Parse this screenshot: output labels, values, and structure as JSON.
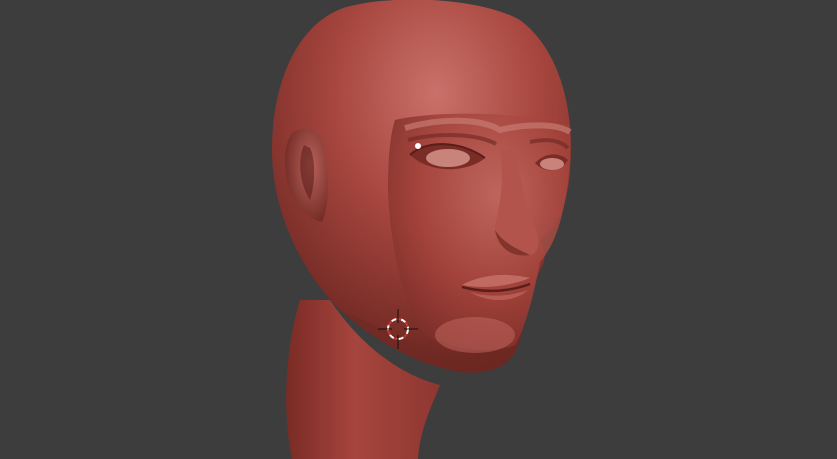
{
  "viewport": {
    "background_color": "#3d3d3d",
    "mode": "sculpt"
  },
  "model": {
    "object": "head-sculpt",
    "base_color": "#a8473f",
    "highlight_color": "#c9716a",
    "shadow_color": "#5e201c"
  },
  "cursor": {
    "icon": "3d-cursor-icon",
    "ring_color_a": "#ffffff",
    "ring_color_b": "#c0392b"
  }
}
